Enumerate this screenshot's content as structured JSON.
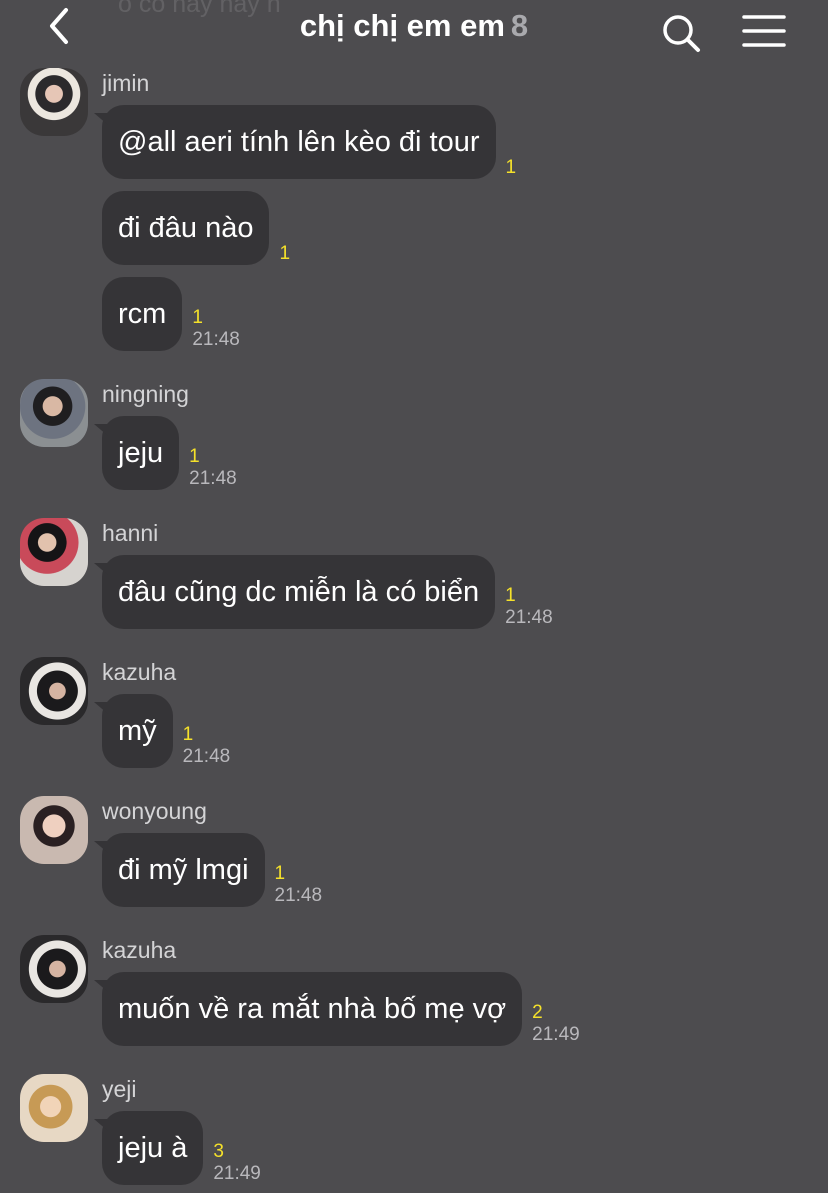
{
  "header": {
    "ghost_text": "ô có hay hay h",
    "title": "chị chị em em",
    "member_count": "8"
  },
  "colors": {
    "background": "#4d4c4f",
    "bubble": "#353437",
    "unread": "#f5e12a",
    "time": "#b9b8bc"
  },
  "messages": [
    {
      "sender": "jimin",
      "bubbles": [
        {
          "text": "@all aeri tính lên kèo đi tour",
          "unread": "1",
          "time": ""
        },
        {
          "text": "đi đâu nào",
          "unread": "1",
          "time": ""
        },
        {
          "text": "rcm",
          "unread": "1",
          "time": "21:48"
        }
      ]
    },
    {
      "sender": "ningning",
      "bubbles": [
        {
          "text": "jeju",
          "unread": "1",
          "time": "21:48"
        }
      ]
    },
    {
      "sender": "hanni",
      "bubbles": [
        {
          "text": "đâu cũng dc miễn là có biển",
          "unread": "1",
          "time": "21:48"
        }
      ]
    },
    {
      "sender": "kazuha",
      "bubbles": [
        {
          "text": "mỹ",
          "unread": "1",
          "time": "21:48"
        }
      ]
    },
    {
      "sender": "wonyoung",
      "bubbles": [
        {
          "text": "đi mỹ lmgi",
          "unread": "1",
          "time": "21:48"
        }
      ]
    },
    {
      "sender": "kazuha",
      "bubbles": [
        {
          "text": "muốn về ra mắt nhà bố mẹ vợ",
          "unread": "2",
          "time": "21:49"
        }
      ]
    },
    {
      "sender": "yeji",
      "bubbles": [
        {
          "text": "jeju à",
          "unread": "3",
          "time": "21:49"
        }
      ]
    }
  ]
}
